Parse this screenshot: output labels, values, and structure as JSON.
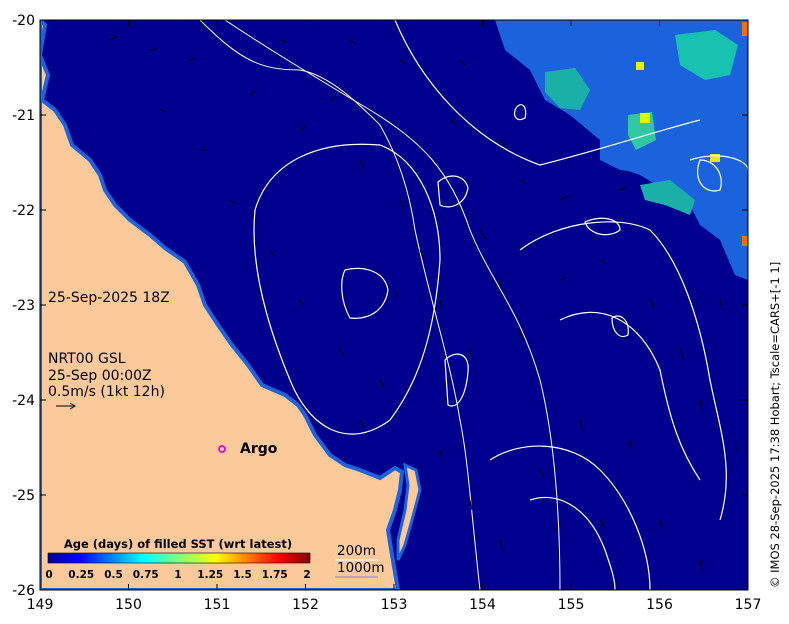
{
  "map": {
    "x_ticks": [
      "149",
      "150",
      "151",
      "152",
      "153",
      "154",
      "155",
      "156",
      "157"
    ],
    "y_ticks": [
      "-20",
      "-21",
      "-22",
      "-23",
      "-24",
      "-25",
      "-26"
    ],
    "date_label": "25-Sep-2025 18Z",
    "current_source": "NRT00 GSL",
    "current_date": "25-Sep 00:00Z",
    "vector_scale": "0.5m/s (1kt 12h)",
    "argo_label": "Argo",
    "colorbar": {
      "title": "Age (days) of filled SST (wrt latest)",
      "ticks": [
        "0",
        "0.25",
        "0.5",
        "0.75",
        "1",
        "1.25",
        "1.5",
        "1.75",
        "2"
      ]
    },
    "bathy_labels": [
      "200m",
      "1000m"
    ],
    "credit": "© IMOS 28-Sep-2025 17:38 Hobart; Tscale=CARS+[-1 1]",
    "colors": {
      "ocean": "#00008e",
      "land": "#fcc99b",
      "shelf": "#1c64dc",
      "argo": "#e000e0"
    }
  }
}
